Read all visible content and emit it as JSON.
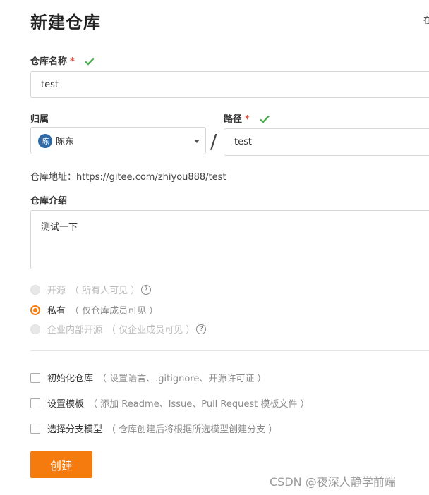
{
  "page": {
    "title": "新建仓库",
    "top_right_partial": "在"
  },
  "repo_name": {
    "label": "仓库名称",
    "required_mark": "*",
    "value": "test"
  },
  "owner": {
    "label": "归属",
    "avatar_text": "陈",
    "name": "陈东"
  },
  "path": {
    "label": "路径",
    "required_mark": "*",
    "value": "test",
    "separator": "/"
  },
  "repo_address": {
    "text": "仓库地址：https://gitee.com/zhiyou888/test"
  },
  "intro": {
    "label": "仓库介绍",
    "value": "测试一下"
  },
  "visibility": {
    "options": [
      {
        "label": "开源",
        "note": "（ 所有人可见 ）",
        "state": "disabled"
      },
      {
        "label": "私有",
        "note": "（ 仅仓库成员可见 ）",
        "state": "checked"
      },
      {
        "label": "企业内部开源",
        "note": "（ 仅企业成员可见 ）",
        "state": "disabled"
      }
    ]
  },
  "options": {
    "items": [
      {
        "label": "初始化仓库",
        "note": "（ 设置语言、.gitignore、开源许可证 ）"
      },
      {
        "label": "设置模板",
        "note": "（ 添加 Readme、Issue、Pull Request 模板文件 ）"
      },
      {
        "label": "选择分支模型",
        "note": "（ 仓库创建后将根据所选模型创建分支 ）"
      }
    ]
  },
  "actions": {
    "create_label": "创建"
  },
  "watermark": "CSDN @夜深人静学前端",
  "colors": {
    "accent": "#f57b0e",
    "success": "#4caf50",
    "required": "#e74c3c"
  }
}
